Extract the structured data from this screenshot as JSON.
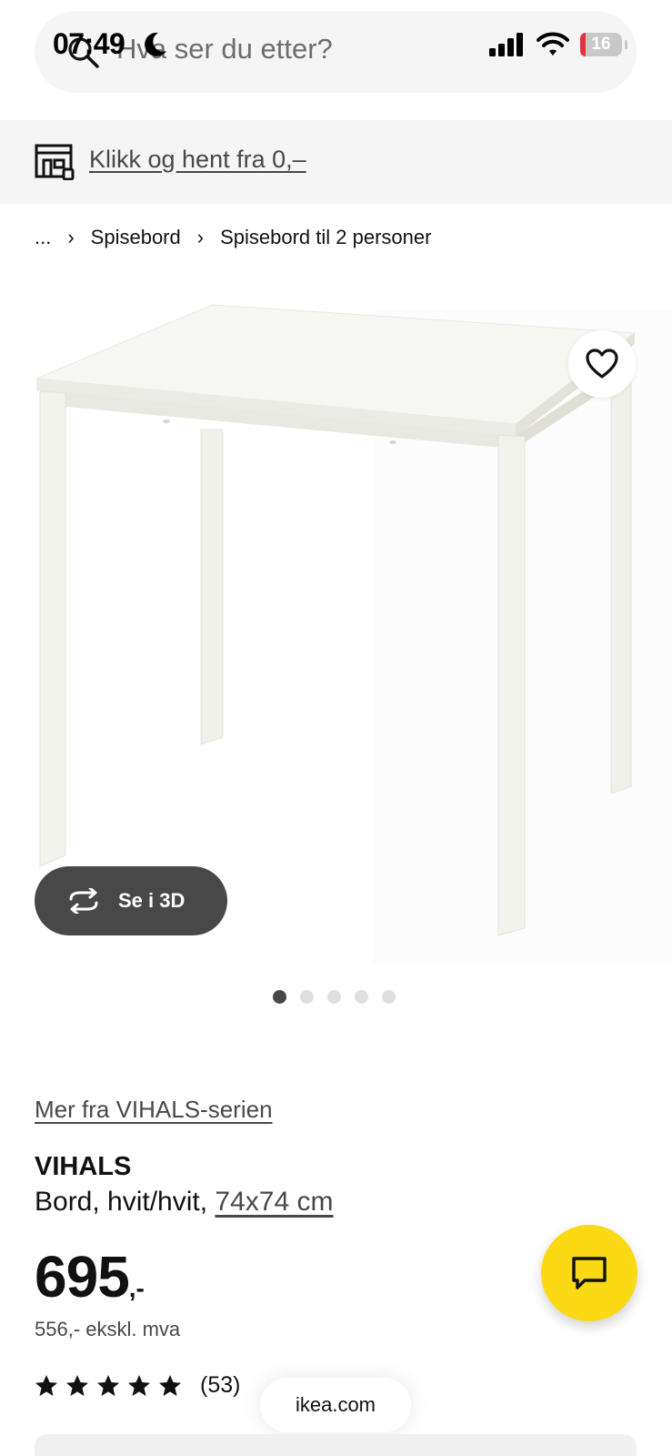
{
  "status_bar": {
    "time": "07:49",
    "battery": "16"
  },
  "search": {
    "placeholder": "Hva ser du etter?"
  },
  "banner": {
    "text": "Klikk og hent fra 0,–"
  },
  "breadcrumb": {
    "items": [
      "...",
      "Spisebord",
      "Spisebord til 2 personer"
    ],
    "separator": "›"
  },
  "gallery": {
    "view_3d_label": "Se i 3D",
    "image_count": 5,
    "active_index": 0
  },
  "product": {
    "series_link": "Mer fra VIHALS-serien",
    "name": "VIHALS",
    "description": "Bord, hvit/hvit,",
    "size": "74x74 cm",
    "price_integer": "695",
    "price_suffix": ",-",
    "price_excl_vat": "556,- ekskl. mva",
    "rating_stars": 5,
    "rating_count": "(53)"
  },
  "browser": {
    "url": "ikea.com"
  },
  "colors": {
    "accent_yellow": "#FBD914",
    "dark_grey": "#484848",
    "light_grey": "#F5F5F5"
  },
  "icons": [
    "search-icon",
    "moon-icon",
    "signal-icon",
    "wifi-icon",
    "store-icon",
    "heart-icon",
    "rotate-3d-icon",
    "star-icon",
    "chat-icon"
  ]
}
